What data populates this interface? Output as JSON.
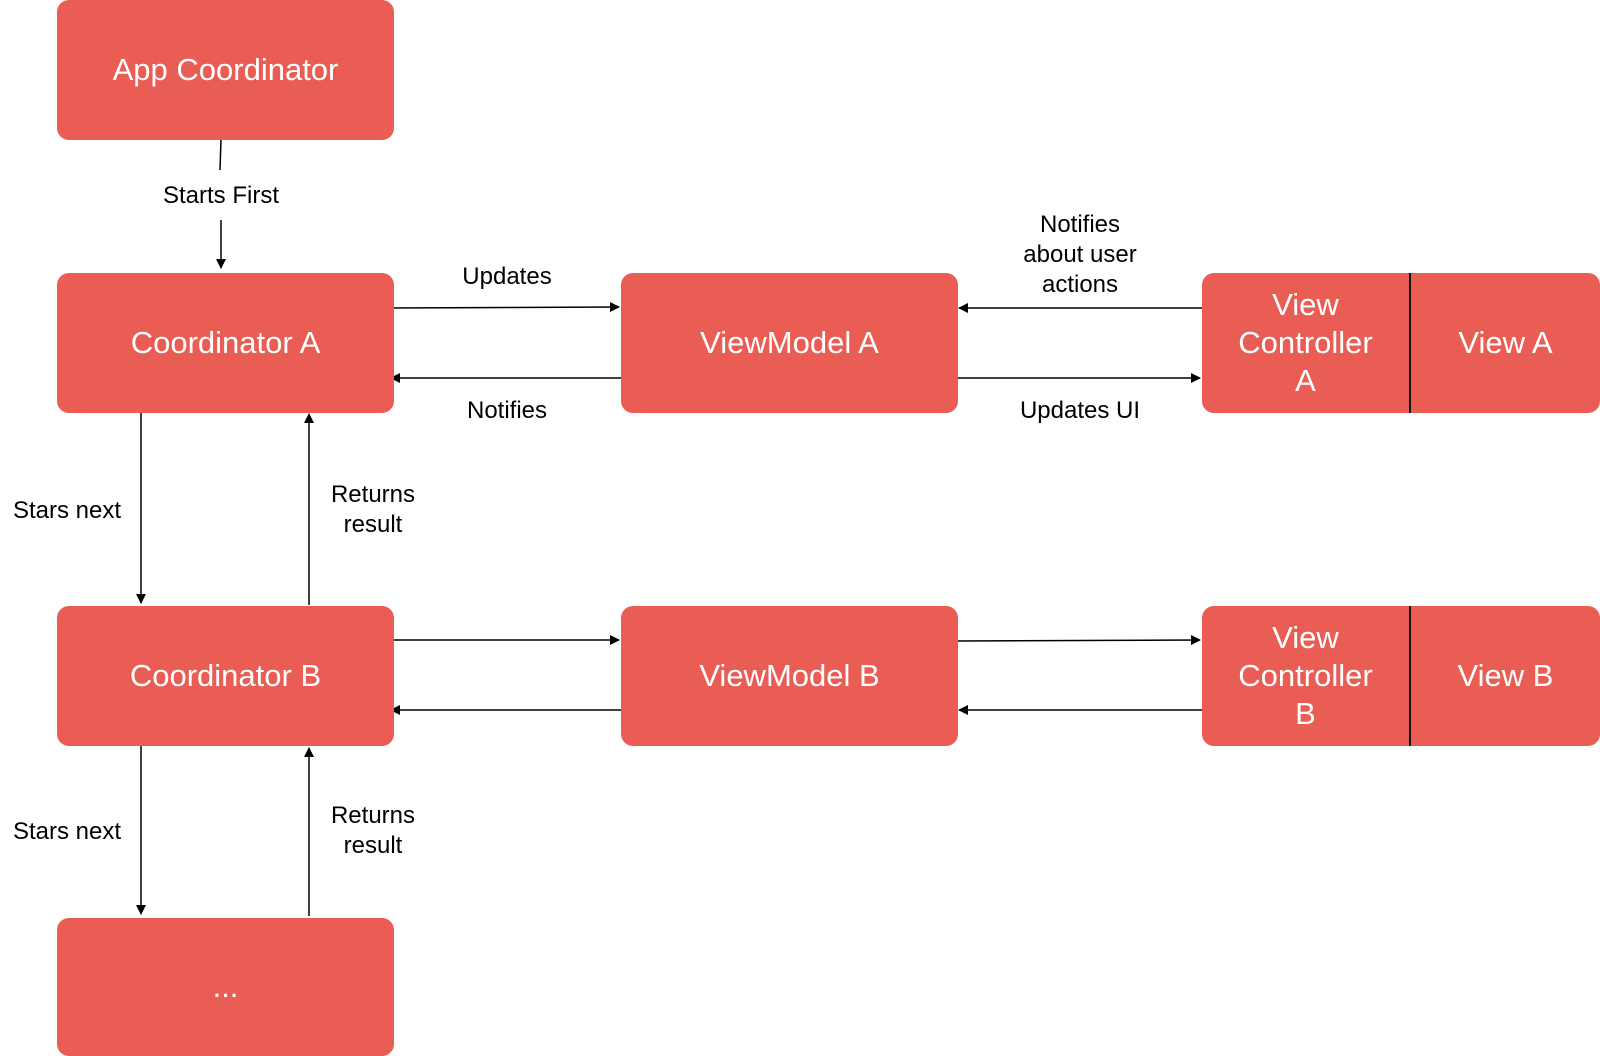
{
  "diagram": {
    "colors": {
      "node_fill": "#E95D55",
      "node_text": "#FFFFFF",
      "edge": "#000000"
    },
    "nodes": {
      "app_coordinator": "App Coordinator",
      "coordinator_a": "Coordinator A",
      "coordinator_b": "Coordinator B",
      "coordinator_next": "...",
      "viewmodel_a": "ViewModel A",
      "viewmodel_b": "ViewModel B",
      "view_controller_a": [
        "View",
        "Controller",
        "A"
      ],
      "view_a": "View A",
      "view_controller_b": [
        "View",
        "Controller",
        "B"
      ],
      "view_b": "View B"
    },
    "edges": [
      {
        "from": "app_coordinator",
        "to": "coordinator_a",
        "label": "Starts First"
      },
      {
        "from": "coordinator_a",
        "to": "viewmodel_a",
        "label": "Updates"
      },
      {
        "from": "viewmodel_a",
        "to": "coordinator_a",
        "label": "Notifies"
      },
      {
        "from": "view_controller_a",
        "to": "viewmodel_a",
        "label": "Notifies about user actions"
      },
      {
        "from": "viewmodel_a",
        "to": "view_controller_a",
        "label": "Updates UI"
      },
      {
        "from": "coordinator_a",
        "to": "coordinator_b",
        "label": "Stars next"
      },
      {
        "from": "coordinator_b",
        "to": "coordinator_a",
        "label": "Returns result"
      },
      {
        "from": "coordinator_b",
        "to": "viewmodel_b",
        "label": ""
      },
      {
        "from": "viewmodel_b",
        "to": "coordinator_b",
        "label": ""
      },
      {
        "from": "viewmodel_b",
        "to": "view_controller_b",
        "label": ""
      },
      {
        "from": "view_controller_b",
        "to": "viewmodel_b",
        "label": ""
      },
      {
        "from": "coordinator_b",
        "to": "coordinator_next",
        "label": "Stars next"
      },
      {
        "from": "coordinator_next",
        "to": "coordinator_b",
        "label": "Returns result"
      }
    ],
    "labels": {
      "starts_first": "Starts First",
      "updates": "Updates",
      "notifies": "Notifies",
      "notifies_user_actions": [
        "Notifies",
        "about user",
        "actions"
      ],
      "updates_ui": "Updates UI",
      "stars_next_1": "Stars next",
      "returns_result_1": [
        "Returns",
        "result"
      ],
      "stars_next_2": "Stars next",
      "returns_result_2": [
        "Returns",
        "result"
      ]
    }
  }
}
